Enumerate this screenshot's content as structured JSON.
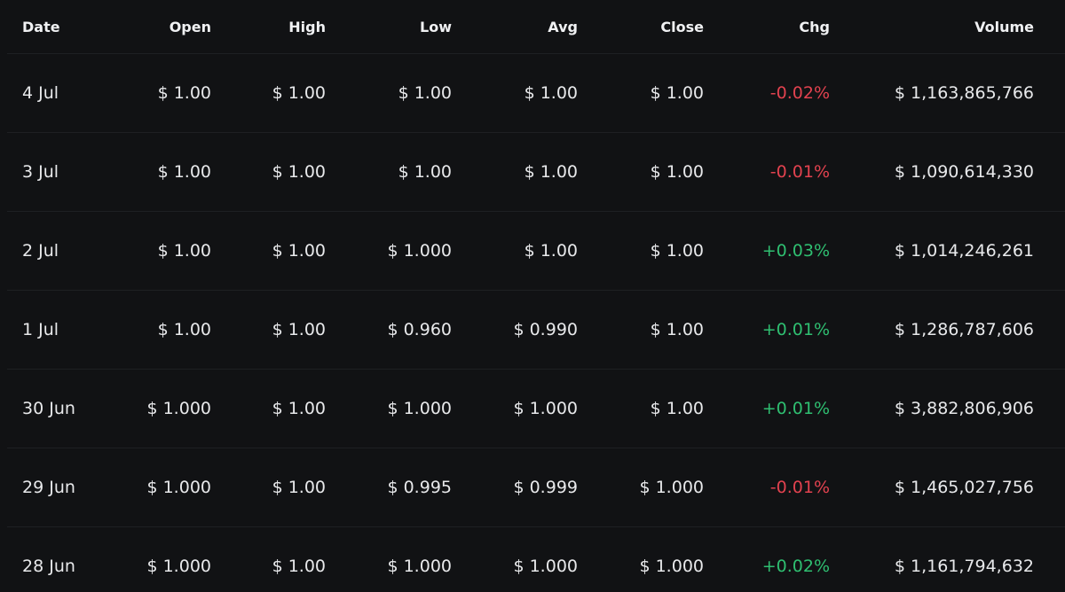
{
  "columns": {
    "date": "Date",
    "open": "Open",
    "high": "High",
    "low": "Low",
    "avg": "Avg",
    "close": "Close",
    "chg": "Chg",
    "volume": "Volume"
  },
  "colors": {
    "background": "#111214",
    "negative": "#e2424f",
    "positive": "#2fbf71"
  },
  "rows": [
    {
      "date": "4 Jul",
      "open": "$ 1.00",
      "high": "$ 1.00",
      "low": "$ 1.00",
      "avg": "$ 1.00",
      "close": "$ 1.00",
      "chg": "-0.02%",
      "volume": "$ 1,163,865,766"
    },
    {
      "date": "3 Jul",
      "open": "$ 1.00",
      "high": "$ 1.00",
      "low": "$ 1.00",
      "avg": "$ 1.00",
      "close": "$ 1.00",
      "chg": "-0.01%",
      "volume": "$ 1,090,614,330"
    },
    {
      "date": "2 Jul",
      "open": "$ 1.00",
      "high": "$ 1.00",
      "low": "$ 1.000",
      "avg": "$ 1.00",
      "close": "$ 1.00",
      "chg": "+0.03%",
      "volume": "$ 1,014,246,261"
    },
    {
      "date": "1 Jul",
      "open": "$ 1.00",
      "high": "$ 1.00",
      "low": "$ 0.960",
      "avg": "$ 0.990",
      "close": "$ 1.00",
      "chg": "+0.01%",
      "volume": "$ 1,286,787,606"
    },
    {
      "date": "30 Jun",
      "open": "$ 1.000",
      "high": "$ 1.00",
      "low": "$ 1.000",
      "avg": "$ 1.000",
      "close": "$ 1.00",
      "chg": "+0.01%",
      "volume": "$ 3,882,806,906"
    },
    {
      "date": "29 Jun",
      "open": "$ 1.000",
      "high": "$ 1.00",
      "low": "$ 0.995",
      "avg": "$ 0.999",
      "close": "$ 1.000",
      "chg": "-0.01%",
      "volume": "$ 1,465,027,756"
    },
    {
      "date": "28 Jun",
      "open": "$ 1.000",
      "high": "$ 1.00",
      "low": "$ 1.000",
      "avg": "$ 1.000",
      "close": "$ 1.000",
      "chg": "+0.02%",
      "volume": "$ 1,161,794,632"
    }
  ]
}
